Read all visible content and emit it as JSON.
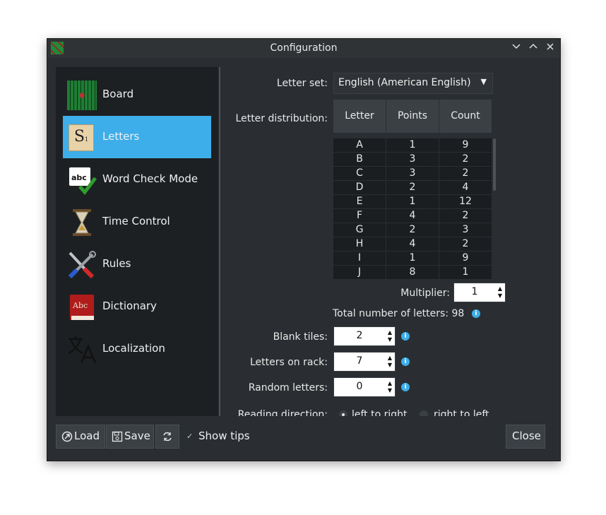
{
  "window": {
    "title": "Configuration"
  },
  "sidebar": {
    "items": [
      {
        "label": "Board",
        "icon": "board-icon"
      },
      {
        "label": "Letters",
        "icon": "letter-tile-icon"
      },
      {
        "label": "Word Check Mode",
        "icon": "spellcheck-icon"
      },
      {
        "label": "Time Control",
        "icon": "hourglass-icon"
      },
      {
        "label": "Rules",
        "icon": "tools-icon"
      },
      {
        "label": "Dictionary",
        "icon": "book-icon"
      },
      {
        "label": "Localization",
        "icon": "translate-icon"
      }
    ]
  },
  "letters": {
    "letter_set_label": "Letter set:",
    "letter_set_value": "English (American English)",
    "distribution_label": "Letter distribution:",
    "columns": [
      "Letter",
      "Points",
      "Count"
    ],
    "rows": [
      [
        "A",
        "1",
        "9"
      ],
      [
        "B",
        "3",
        "2"
      ],
      [
        "C",
        "3",
        "2"
      ],
      [
        "D",
        "2",
        "4"
      ],
      [
        "E",
        "1",
        "12"
      ],
      [
        "F",
        "4",
        "2"
      ],
      [
        "G",
        "2",
        "3"
      ],
      [
        "H",
        "4",
        "2"
      ],
      [
        "I",
        "1",
        "9"
      ],
      [
        "J",
        "8",
        "1"
      ]
    ],
    "multiplier_label": "Multiplier:",
    "multiplier_value": "1",
    "total_text": "Total number of letters: 98",
    "blank_label": "Blank tiles:",
    "blank_value": "2",
    "rack_label": "Letters on rack:",
    "rack_value": "7",
    "random_label": "Random letters:",
    "random_value": "0",
    "reading_label": "Reading direction:",
    "ltr_label": "left to right",
    "rtl_label": "right to left"
  },
  "footer": {
    "load": "Load",
    "save": "Save",
    "show_tips": "Show tips",
    "close": "Close"
  },
  "colors": {
    "accent": "#3daee9",
    "window_bg": "#2a2e32",
    "panel_bg": "#1d2023"
  }
}
